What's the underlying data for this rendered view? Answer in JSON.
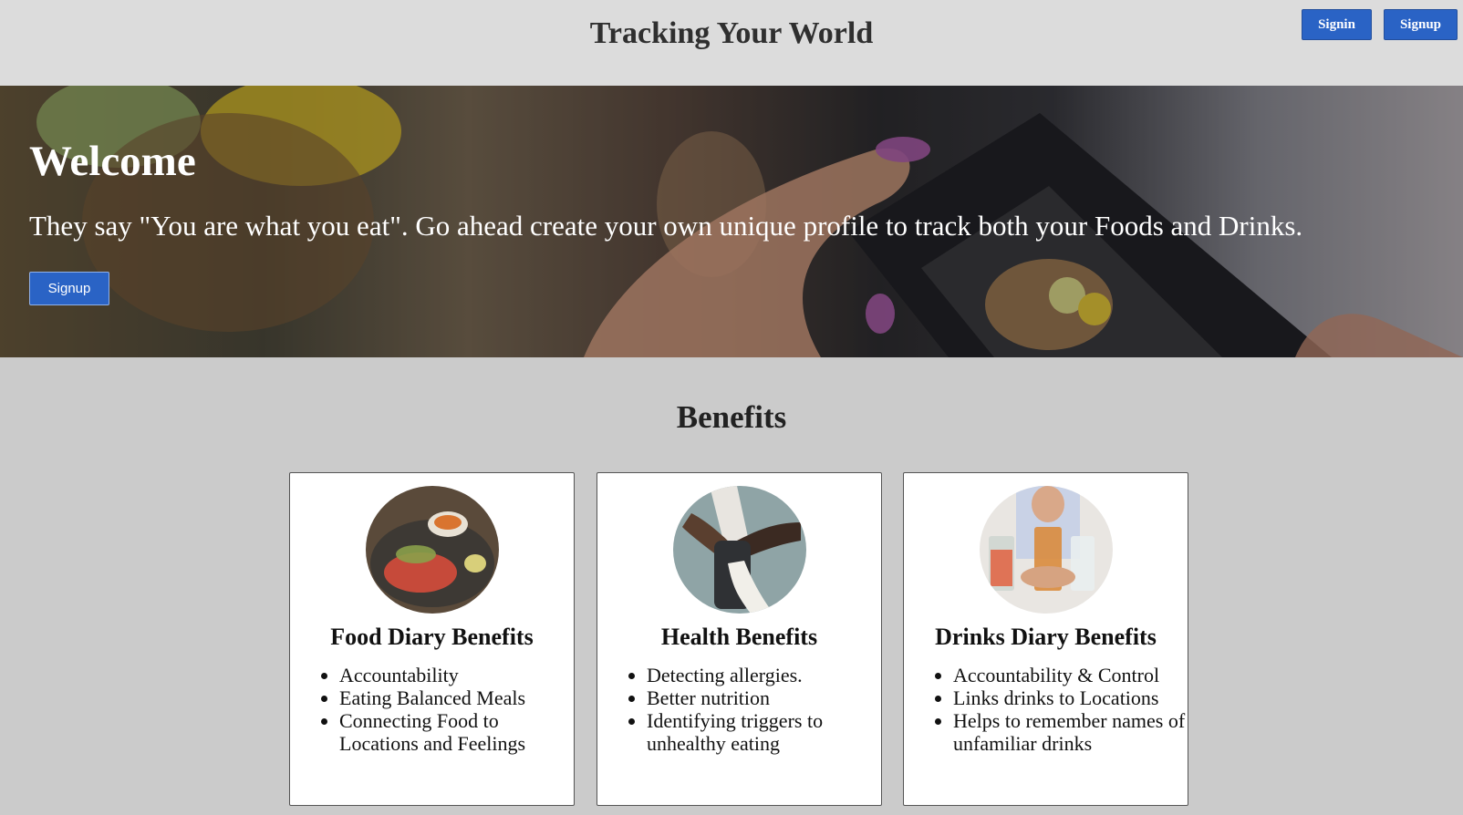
{
  "header": {
    "title": "Tracking Your World",
    "signin_label": "Signin",
    "signup_label": "Signup"
  },
  "hero": {
    "heading": "Welcome",
    "tagline": "They say \"You are what you eat\". Go ahead create your own unique profile to track both your Foods and Drinks.",
    "signup_label": "Signup"
  },
  "benefits": {
    "title": "Benefits",
    "cards": [
      {
        "title": "Food Diary Benefits",
        "items": [
          "Accountability",
          "Eating Balanced Meals",
          "Connecting Food to Locations and Feelings"
        ]
      },
      {
        "title": "Health Benefits",
        "items": [
          "Detecting allergies.",
          "Better nutrition",
          "Identifying triggers to unhealthy eating"
        ]
      },
      {
        "title": "Drinks Diary Benefits",
        "items": [
          "Accountability & Control",
          "Links drinks to Locations",
          "Helps to remember names of unfamiliar drinks"
        ]
      }
    ]
  },
  "colors": {
    "accent": "#2a63c5",
    "header_bg": "#dcdcdc",
    "page_bg": "#cbcbcb"
  }
}
